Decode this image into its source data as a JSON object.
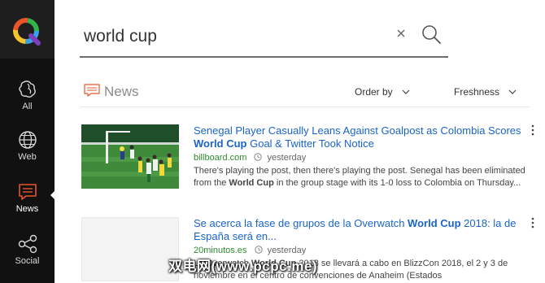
{
  "sidebar": {
    "items": [
      {
        "label": "All",
        "icon": "all-blobs-icon"
      },
      {
        "label": "Web",
        "icon": "globe-icon"
      },
      {
        "label": "News",
        "icon": "news-icon",
        "active": true
      },
      {
        "label": "Social",
        "icon": "share-icon"
      }
    ]
  },
  "search": {
    "value": "world cup"
  },
  "news_header": {
    "title": "News",
    "order_label": "Order by",
    "freshness_label": "Freshness"
  },
  "articles": [
    {
      "title_pre": "Senegal Player Casually Leans Against Goalpost as Colombia Scores ",
      "title_bold": "World Cup",
      "title_post": " Goal & Twitter Took Notice",
      "source": "billboard.com",
      "time": "yesterday",
      "snippet_pre": "There's playing the post, then there's playing the post. Senegal has been eliminated from the ",
      "snippet_bold": "World Cup",
      "snippet_post": " in the group stage with its 1-0 loss to Colombia on Thursday..."
    },
    {
      "title_pre": "Se acerca la fase de grupos de la Overwatch ",
      "title_bold": "World Cup",
      "title_post": " 2018: la de España será en...",
      "source": "20minutos.es",
      "time": "yesterday",
      "snippet_pre": "La Overwatch ",
      "snippet_bold": "World Cup",
      "snippet_post": " 2018 se llevará a cabo en BlizzCon 2018, el 2 y 3 de noviembre en el centro de convenciones de Anaheim (Estados"
    }
  ],
  "watermark": "双电网(www.pcpc.me)",
  "colors": {
    "sidebar": "#111111",
    "accent": "#e8552b",
    "link": "#1a64c8",
    "source": "#2e8b2e"
  }
}
